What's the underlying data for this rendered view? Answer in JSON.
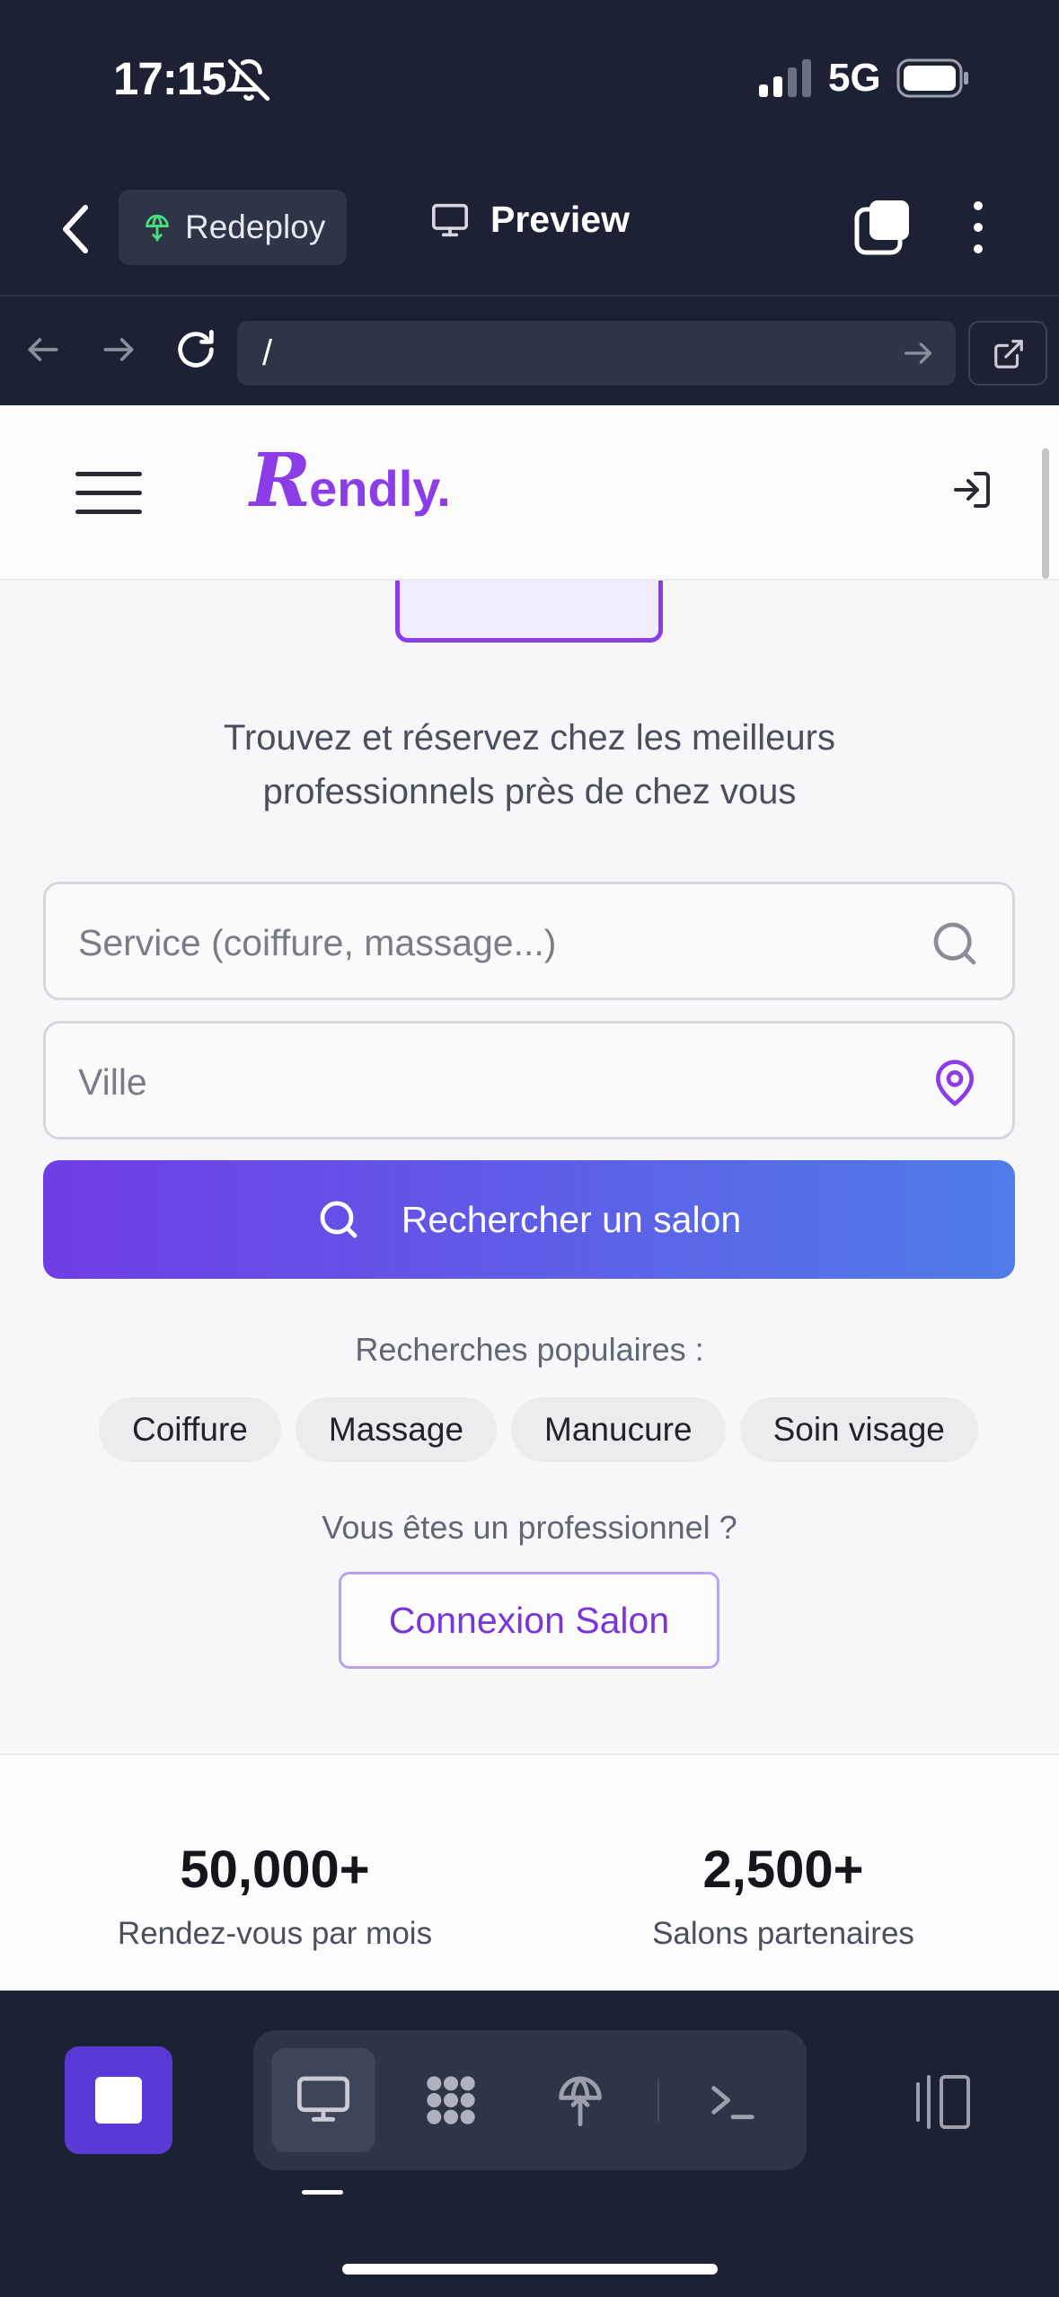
{
  "status_bar": {
    "time": "17:15",
    "network": "5G"
  },
  "app_header": {
    "redeploy_label": "Redeploy",
    "preview_label": "Preview"
  },
  "url_bar": {
    "url": "/"
  },
  "site": {
    "logo_initial": "R",
    "logo_rest": "endly.",
    "tagline_line1": "Trouvez et réservez chez les meilleurs",
    "tagline_line2": "professionnels près de chez vous",
    "service_placeholder": "Service (coiffure, massage...)",
    "service_value": "",
    "city_placeholder": "Ville",
    "city_value": "",
    "search_button": "Rechercher un salon",
    "popular_title": "Recherches populaires :",
    "popular": [
      "Coiffure",
      "Massage",
      "Manucure",
      "Soin visage"
    ],
    "pro_question": "Vous êtes un professionnel ?",
    "pro_button": "Connexion Salon",
    "stats": [
      {
        "value": "50,000+",
        "label": "Rendez-vous par mois"
      },
      {
        "value": "2,500+",
        "label": "Salons partenaires"
      }
    ]
  },
  "colors": {
    "brand": "#8b3de8",
    "gradient_start": "#6f3de6",
    "gradient_end": "#4f7ce8",
    "chrome_bg": "#1c2233",
    "stop_button": "#5a3ad6"
  },
  "icons": {
    "status": [
      "bell-slash-icon",
      "signal-icon",
      "battery-icon"
    ],
    "header": [
      "chevron-left-icon",
      "globe-icon",
      "monitor-icon",
      "tabs-icon",
      "more-vertical-icon"
    ],
    "url": [
      "arrow-left-icon",
      "arrow-right-icon",
      "reload-icon",
      "arrow-right-small-icon",
      "external-link-icon"
    ],
    "site": [
      "menu-icon",
      "login-icon",
      "search-icon",
      "map-pin-icon"
    ],
    "toolbar": [
      "stop-icon",
      "desktop-icon",
      "grid-icon",
      "deploy-icon",
      "terminal-icon",
      "split-view-icon"
    ]
  }
}
